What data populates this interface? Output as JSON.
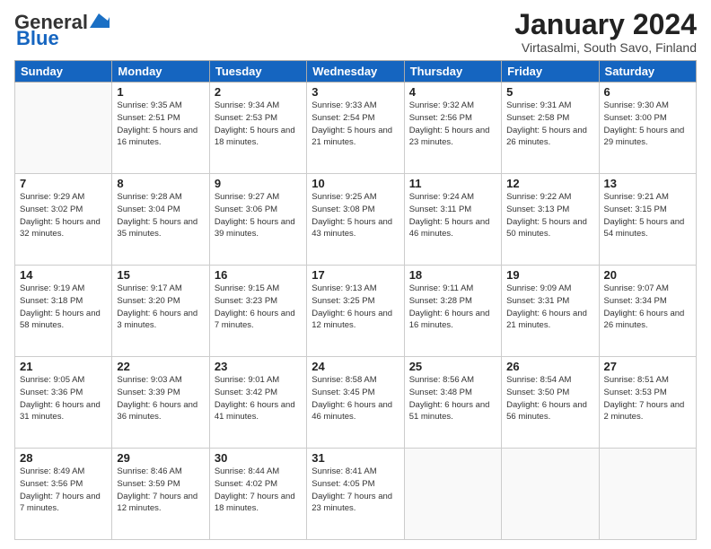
{
  "header": {
    "logo_general": "General",
    "logo_blue": "Blue",
    "month_title": "January 2024",
    "location": "Virtasalmi, South Savo, Finland"
  },
  "days_of_week": [
    "Sunday",
    "Monday",
    "Tuesday",
    "Wednesday",
    "Thursday",
    "Friday",
    "Saturday"
  ],
  "weeks": [
    [
      {
        "day": "",
        "sunrise": "",
        "sunset": "",
        "daylight": ""
      },
      {
        "day": "1",
        "sunrise": "Sunrise: 9:35 AM",
        "sunset": "Sunset: 2:51 PM",
        "daylight": "Daylight: 5 hours and 16 minutes."
      },
      {
        "day": "2",
        "sunrise": "Sunrise: 9:34 AM",
        "sunset": "Sunset: 2:53 PM",
        "daylight": "Daylight: 5 hours and 18 minutes."
      },
      {
        "day": "3",
        "sunrise": "Sunrise: 9:33 AM",
        "sunset": "Sunset: 2:54 PM",
        "daylight": "Daylight: 5 hours and 21 minutes."
      },
      {
        "day": "4",
        "sunrise": "Sunrise: 9:32 AM",
        "sunset": "Sunset: 2:56 PM",
        "daylight": "Daylight: 5 hours and 23 minutes."
      },
      {
        "day": "5",
        "sunrise": "Sunrise: 9:31 AM",
        "sunset": "Sunset: 2:58 PM",
        "daylight": "Daylight: 5 hours and 26 minutes."
      },
      {
        "day": "6",
        "sunrise": "Sunrise: 9:30 AM",
        "sunset": "Sunset: 3:00 PM",
        "daylight": "Daylight: 5 hours and 29 minutes."
      }
    ],
    [
      {
        "day": "7",
        "sunrise": "Sunrise: 9:29 AM",
        "sunset": "Sunset: 3:02 PM",
        "daylight": "Daylight: 5 hours and 32 minutes."
      },
      {
        "day": "8",
        "sunrise": "Sunrise: 9:28 AM",
        "sunset": "Sunset: 3:04 PM",
        "daylight": "Daylight: 5 hours and 35 minutes."
      },
      {
        "day": "9",
        "sunrise": "Sunrise: 9:27 AM",
        "sunset": "Sunset: 3:06 PM",
        "daylight": "Daylight: 5 hours and 39 minutes."
      },
      {
        "day": "10",
        "sunrise": "Sunrise: 9:25 AM",
        "sunset": "Sunset: 3:08 PM",
        "daylight": "Daylight: 5 hours and 43 minutes."
      },
      {
        "day": "11",
        "sunrise": "Sunrise: 9:24 AM",
        "sunset": "Sunset: 3:11 PM",
        "daylight": "Daylight: 5 hours and 46 minutes."
      },
      {
        "day": "12",
        "sunrise": "Sunrise: 9:22 AM",
        "sunset": "Sunset: 3:13 PM",
        "daylight": "Daylight: 5 hours and 50 minutes."
      },
      {
        "day": "13",
        "sunrise": "Sunrise: 9:21 AM",
        "sunset": "Sunset: 3:15 PM",
        "daylight": "Daylight: 5 hours and 54 minutes."
      }
    ],
    [
      {
        "day": "14",
        "sunrise": "Sunrise: 9:19 AM",
        "sunset": "Sunset: 3:18 PM",
        "daylight": "Daylight: 5 hours and 58 minutes."
      },
      {
        "day": "15",
        "sunrise": "Sunrise: 9:17 AM",
        "sunset": "Sunset: 3:20 PM",
        "daylight": "Daylight: 6 hours and 3 minutes."
      },
      {
        "day": "16",
        "sunrise": "Sunrise: 9:15 AM",
        "sunset": "Sunset: 3:23 PM",
        "daylight": "Daylight: 6 hours and 7 minutes."
      },
      {
        "day": "17",
        "sunrise": "Sunrise: 9:13 AM",
        "sunset": "Sunset: 3:25 PM",
        "daylight": "Daylight: 6 hours and 12 minutes."
      },
      {
        "day": "18",
        "sunrise": "Sunrise: 9:11 AM",
        "sunset": "Sunset: 3:28 PM",
        "daylight": "Daylight: 6 hours and 16 minutes."
      },
      {
        "day": "19",
        "sunrise": "Sunrise: 9:09 AM",
        "sunset": "Sunset: 3:31 PM",
        "daylight": "Daylight: 6 hours and 21 minutes."
      },
      {
        "day": "20",
        "sunrise": "Sunrise: 9:07 AM",
        "sunset": "Sunset: 3:34 PM",
        "daylight": "Daylight: 6 hours and 26 minutes."
      }
    ],
    [
      {
        "day": "21",
        "sunrise": "Sunrise: 9:05 AM",
        "sunset": "Sunset: 3:36 PM",
        "daylight": "Daylight: 6 hours and 31 minutes."
      },
      {
        "day": "22",
        "sunrise": "Sunrise: 9:03 AM",
        "sunset": "Sunset: 3:39 PM",
        "daylight": "Daylight: 6 hours and 36 minutes."
      },
      {
        "day": "23",
        "sunrise": "Sunrise: 9:01 AM",
        "sunset": "Sunset: 3:42 PM",
        "daylight": "Daylight: 6 hours and 41 minutes."
      },
      {
        "day": "24",
        "sunrise": "Sunrise: 8:58 AM",
        "sunset": "Sunset: 3:45 PM",
        "daylight": "Daylight: 6 hours and 46 minutes."
      },
      {
        "day": "25",
        "sunrise": "Sunrise: 8:56 AM",
        "sunset": "Sunset: 3:48 PM",
        "daylight": "Daylight: 6 hours and 51 minutes."
      },
      {
        "day": "26",
        "sunrise": "Sunrise: 8:54 AM",
        "sunset": "Sunset: 3:50 PM",
        "daylight": "Daylight: 6 hours and 56 minutes."
      },
      {
        "day": "27",
        "sunrise": "Sunrise: 8:51 AM",
        "sunset": "Sunset: 3:53 PM",
        "daylight": "Daylight: 7 hours and 2 minutes."
      }
    ],
    [
      {
        "day": "28",
        "sunrise": "Sunrise: 8:49 AM",
        "sunset": "Sunset: 3:56 PM",
        "daylight": "Daylight: 7 hours and 7 minutes."
      },
      {
        "day": "29",
        "sunrise": "Sunrise: 8:46 AM",
        "sunset": "Sunset: 3:59 PM",
        "daylight": "Daylight: 7 hours and 12 minutes."
      },
      {
        "day": "30",
        "sunrise": "Sunrise: 8:44 AM",
        "sunset": "Sunset: 4:02 PM",
        "daylight": "Daylight: 7 hours and 18 minutes."
      },
      {
        "day": "31",
        "sunrise": "Sunrise: 8:41 AM",
        "sunset": "Sunset: 4:05 PM",
        "daylight": "Daylight: 7 hours and 23 minutes."
      },
      {
        "day": "",
        "sunrise": "",
        "sunset": "",
        "daylight": ""
      },
      {
        "day": "",
        "sunrise": "",
        "sunset": "",
        "daylight": ""
      },
      {
        "day": "",
        "sunrise": "",
        "sunset": "",
        "daylight": ""
      }
    ]
  ]
}
